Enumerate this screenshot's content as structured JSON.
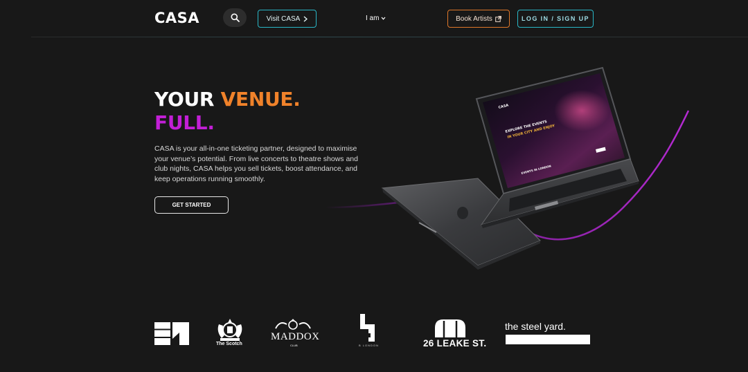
{
  "header": {
    "brand": "CASA",
    "visit_label": "Visit CASA",
    "iam_label": "I am",
    "book_label": "Book Artists",
    "login_label": "LOG IN / SIGN UP"
  },
  "hero": {
    "title_white": "YOUR ",
    "title_orange": "VENUE.",
    "title_purple": "FULL.",
    "description": "CASA is your all-in-one ticketing partner, designed to maximise your venue’s potential. From live concerts to theatre shows and club nights, CASA helps you sell tickets, boost attendance, and keep operations running smoothly.",
    "cta_label": "GET STARTED"
  },
  "laptop_screen": {
    "brand": "CASA",
    "headline_1": "EXPLORE THE EVENTS",
    "headline_2": "IN YOUR CITY AND ENJOY",
    "section": "EVENTS IN LONDON"
  },
  "partners": {
    "scotch_name": "The Scotch",
    "maddox_name": "MADDOX",
    "maddox_sub": "CLUB",
    "b_london": "B LONDON",
    "leake": "26 LEAKE ST.",
    "steel_yard": "the steel yard."
  },
  "colors": {
    "background": "#181818",
    "accent_teal": "#2ab8c8",
    "accent_orange": "#f0822a",
    "accent_purple": "#c21fd6"
  }
}
